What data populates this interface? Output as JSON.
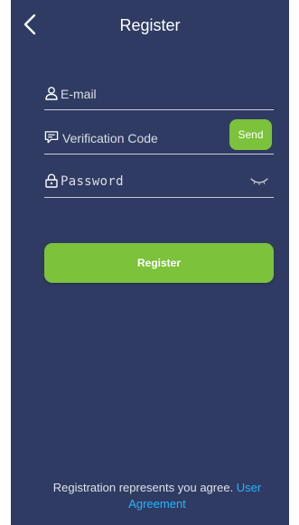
{
  "header": {
    "title": "Register"
  },
  "form": {
    "email": {
      "placeholder": "E-mail",
      "value": ""
    },
    "verification": {
      "placeholder": "Verification Code",
      "value": "",
      "send_label": "Send"
    },
    "password": {
      "placeholder": "Password",
      "value": ""
    },
    "register_label": "Register"
  },
  "footer": {
    "agreement_prefix": "Registration represents you agree. ",
    "agreement_link": "User Agreement"
  },
  "icons": {
    "back": "chevron-left-icon",
    "email": "user-icon",
    "verification": "message-icon",
    "password": "lock-icon",
    "eye": "eye-closed-icon"
  },
  "colors": {
    "background": "#2f3b63",
    "accent": "#7cc23a",
    "link": "#24b6ff",
    "text": "#ffffff"
  }
}
